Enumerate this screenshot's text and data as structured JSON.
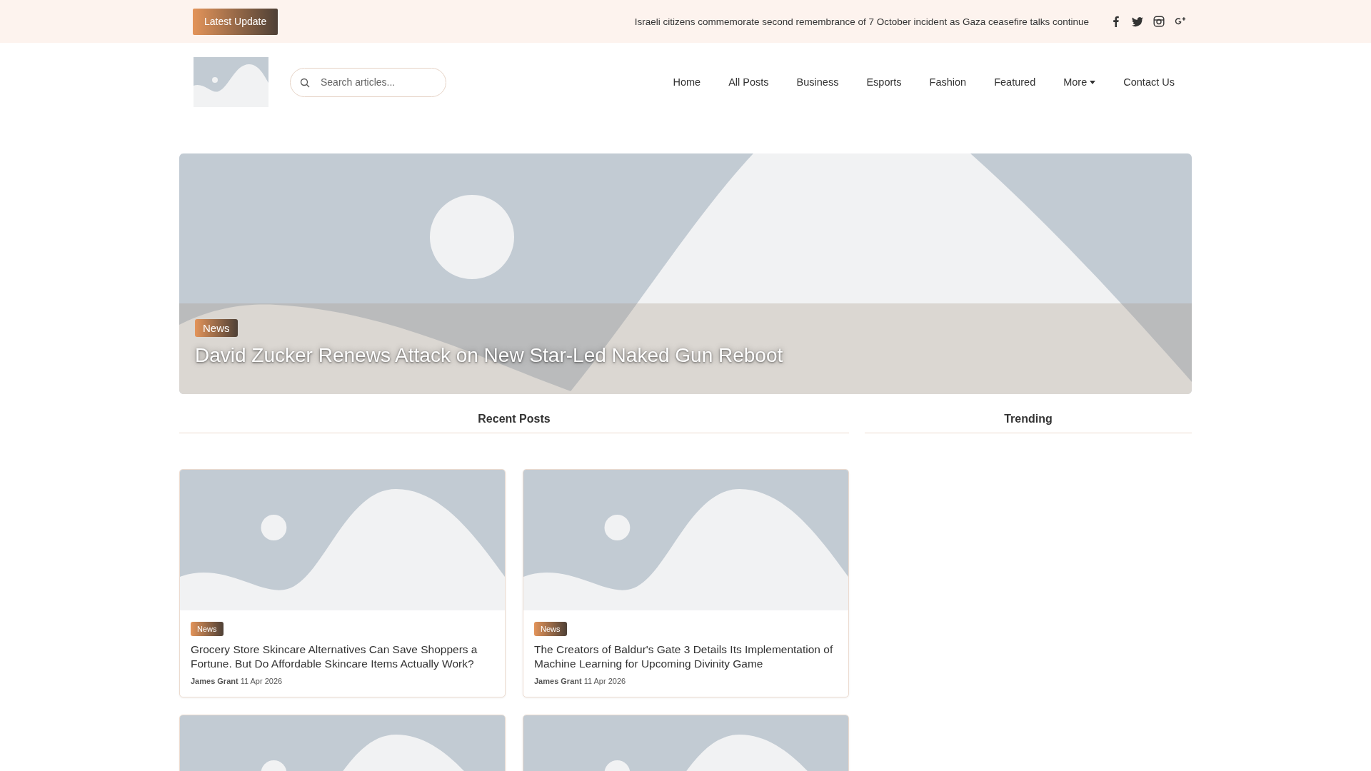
{
  "top_bar": {
    "button": "Latest Update",
    "headline": "Israeli citizens commemorate second remembrance of 7 October incident as Gaza ceasefire talks continue",
    "social": [
      {
        "kind": "facebook"
      },
      {
        "kind": "twitter"
      },
      {
        "kind": "instagram"
      },
      {
        "kind": "google-plus"
      }
    ]
  },
  "header": {
    "logo": {
      "kind": "picture"
    },
    "search": {
      "placeholder": "Search articles..."
    },
    "nav": [
      {
        "label": "Home",
        "dropdown": false
      },
      {
        "label": "All Posts",
        "dropdown": false
      },
      {
        "label": "Business",
        "dropdown": false
      },
      {
        "label": "Esports",
        "dropdown": false
      },
      {
        "label": "Fashion",
        "dropdown": false
      },
      {
        "label": "Featured",
        "dropdown": false
      },
      {
        "label": "More",
        "dropdown": true
      },
      {
        "label": "Contact Us",
        "dropdown": false
      }
    ]
  },
  "hero": {
    "image": {
      "kind": "picture"
    },
    "category": "News",
    "title": "David Zucker Renews Attack on New Star-Led Naked Gun Reboot"
  },
  "recent_posts": {
    "heading": "Recent Posts",
    "posts": [
      {
        "image": {
          "kind": "picture"
        },
        "category": "News",
        "title": "Grocery Store Skincare Alternatives Can Save Shoppers a Fortune. But Do Affordable Skincare Items Actually Work?",
        "author": "James Grant",
        "date": "11 Apr 2026"
      },
      {
        "image": {
          "kind": "picture"
        },
        "category": "News",
        "title": "The Creators of Baldur's Gate 3 Details Its Implementation of Machine Learning for Upcoming Divinity Game",
        "author": "James Grant",
        "date": "11 Apr 2026"
      },
      {
        "image": {
          "kind": "picture"
        }
      },
      {
        "image": {
          "kind": "picture"
        }
      }
    ]
  },
  "trending": {
    "heading": "Trending"
  }
}
